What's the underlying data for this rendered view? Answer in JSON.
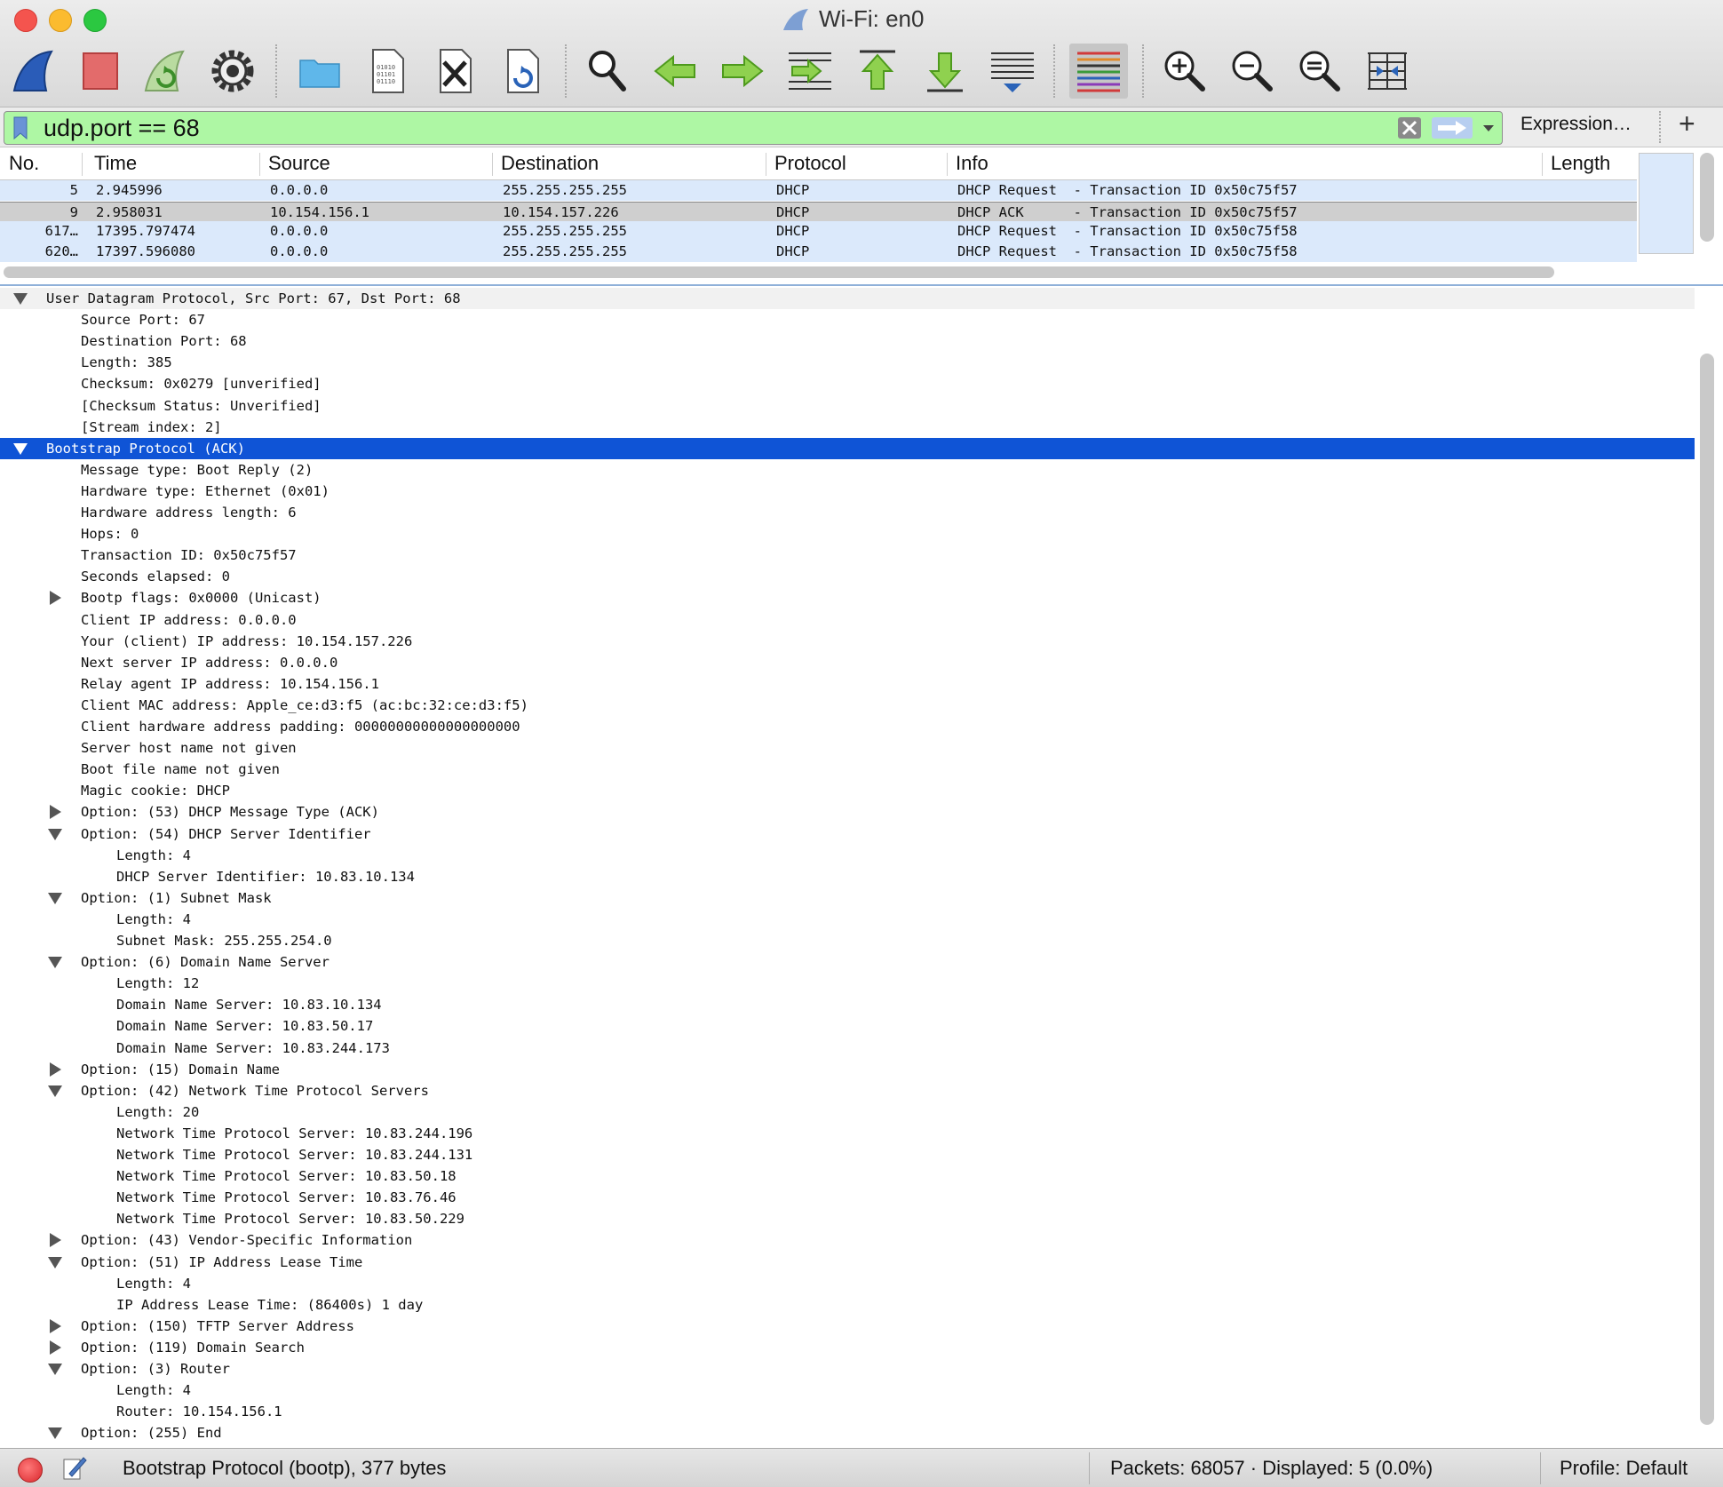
{
  "window": {
    "title": "Wi-Fi: en0",
    "traffic_lights": [
      "#f4544e",
      "#fbbb2f",
      "#2bc841"
    ]
  },
  "toolbar": {
    "buttons": [
      {
        "name": "start-capture",
        "icon": "shark-fin-icon"
      },
      {
        "name": "stop-capture",
        "icon": "stop-square-icon"
      },
      {
        "name": "restart-capture",
        "icon": "restart-fin-icon"
      },
      {
        "name": "capture-options",
        "icon": "gear-icon"
      },
      {
        "name": "open-file",
        "icon": "folder-icon"
      },
      {
        "name": "save-file",
        "icon": "binary-file-icon"
      },
      {
        "name": "close-file",
        "icon": "close-file-icon"
      },
      {
        "name": "reload-file",
        "icon": "reload-file-icon"
      },
      {
        "name": "find-packet",
        "icon": "magnifier-icon"
      },
      {
        "name": "go-back",
        "icon": "arrow-left-icon"
      },
      {
        "name": "go-forward",
        "icon": "arrow-right-icon"
      },
      {
        "name": "go-to-packet",
        "icon": "goto-packet-icon"
      },
      {
        "name": "go-first",
        "icon": "arrow-up-icon"
      },
      {
        "name": "go-last",
        "icon": "arrow-down-icon"
      },
      {
        "name": "auto-scroll",
        "icon": "autoscroll-icon"
      },
      {
        "name": "colorize",
        "icon": "colorize-lines-icon"
      },
      {
        "name": "zoom-in",
        "icon": "zoom-in-icon"
      },
      {
        "name": "zoom-out",
        "icon": "zoom-out-icon"
      },
      {
        "name": "zoom-normal",
        "icon": "zoom-normal-icon"
      },
      {
        "name": "resize-columns",
        "icon": "resize-columns-icon"
      }
    ]
  },
  "filter": {
    "value": "udp.port == 68",
    "expression_label": "Expression…",
    "add_label": "+",
    "bg_color": "#aef7a4"
  },
  "packet_list": {
    "columns": [
      "No.",
      "Time",
      "Source",
      "Destination",
      "Protocol",
      "Info",
      "Length"
    ],
    "rows": [
      {
        "no": "5",
        "time": "2.945996",
        "source": "0.0.0.0",
        "destination": "255.255.255.255",
        "protocol": "DHCP",
        "info": "DHCP Request  - Transaction ID 0x50c75f57",
        "bg": "#dbe9fb"
      },
      {
        "no": "9",
        "time": "2.958031",
        "source": "10.154.156.1",
        "destination": "10.154.157.226",
        "protocol": "DHCP",
        "info": "DHCP ACK      - Transaction ID 0x50c75f57",
        "bg": "#cfcfcf"
      },
      {
        "no": "617…",
        "time": "17395.797474",
        "source": "0.0.0.0",
        "destination": "255.255.255.255",
        "protocol": "DHCP",
        "info": "DHCP Request  - Transaction ID 0x50c75f58",
        "bg": "#dbe9fb"
      },
      {
        "no": "620…",
        "time": "17397.596080",
        "source": "0.0.0.0",
        "destination": "255.255.255.255",
        "protocol": "DHCP",
        "info": "DHCP Request  - Transaction ID 0x50c75f58",
        "bg": "#dbe9fb"
      }
    ]
  },
  "details": [
    {
      "level": 0,
      "tri": "down",
      "text": "User Datagram Protocol, Src Port: 67, Dst Port: 68",
      "bg": "#f1f1f1"
    },
    {
      "level": 1,
      "tri": "",
      "text": "Source Port: 67"
    },
    {
      "level": 1,
      "tri": "",
      "text": "Destination Port: 68"
    },
    {
      "level": 1,
      "tri": "",
      "text": "Length: 385"
    },
    {
      "level": 1,
      "tri": "",
      "text": "Checksum: 0x0279 [unverified]"
    },
    {
      "level": 1,
      "tri": "",
      "text": "[Checksum Status: Unverified]"
    },
    {
      "level": 1,
      "tri": "",
      "text": "[Stream index: 2]"
    },
    {
      "level": 0,
      "tri": "down",
      "text": "Bootstrap Protocol (ACK)",
      "selected": true
    },
    {
      "level": 1,
      "tri": "",
      "text": "Message type: Boot Reply (2)"
    },
    {
      "level": 1,
      "tri": "",
      "text": "Hardware type: Ethernet (0x01)"
    },
    {
      "level": 1,
      "tri": "",
      "text": "Hardware address length: 6"
    },
    {
      "level": 1,
      "tri": "",
      "text": "Hops: 0"
    },
    {
      "level": 1,
      "tri": "",
      "text": "Transaction ID: 0x50c75f57"
    },
    {
      "level": 1,
      "tri": "",
      "text": "Seconds elapsed: 0"
    },
    {
      "level": 1,
      "tri": "right",
      "text": "Bootp flags: 0x0000 (Unicast)"
    },
    {
      "level": 1,
      "tri": "",
      "text": "Client IP address: 0.0.0.0"
    },
    {
      "level": 1,
      "tri": "",
      "text": "Your (client) IP address: 10.154.157.226"
    },
    {
      "level": 1,
      "tri": "",
      "text": "Next server IP address: 0.0.0.0"
    },
    {
      "level": 1,
      "tri": "",
      "text": "Relay agent IP address: 10.154.156.1"
    },
    {
      "level": 1,
      "tri": "",
      "text": "Client MAC address: Apple_ce:d3:f5 (ac:bc:32:ce:d3:f5)"
    },
    {
      "level": 1,
      "tri": "",
      "text": "Client hardware address padding: 00000000000000000000"
    },
    {
      "level": 1,
      "tri": "",
      "text": "Server host name not given"
    },
    {
      "level": 1,
      "tri": "",
      "text": "Boot file name not given"
    },
    {
      "level": 1,
      "tri": "",
      "text": "Magic cookie: DHCP"
    },
    {
      "level": 1,
      "tri": "right",
      "text": "Option: (53) DHCP Message Type (ACK)"
    },
    {
      "level": 1,
      "tri": "down",
      "text": "Option: (54) DHCP Server Identifier"
    },
    {
      "level": 2,
      "tri": "",
      "text": "Length: 4"
    },
    {
      "level": 2,
      "tri": "",
      "text": "DHCP Server Identifier: 10.83.10.134"
    },
    {
      "level": 1,
      "tri": "down",
      "text": "Option: (1) Subnet Mask"
    },
    {
      "level": 2,
      "tri": "",
      "text": "Length: 4"
    },
    {
      "level": 2,
      "tri": "",
      "text": "Subnet Mask: 255.255.254.0"
    },
    {
      "level": 1,
      "tri": "down",
      "text": "Option: (6) Domain Name Server"
    },
    {
      "level": 2,
      "tri": "",
      "text": "Length: 12"
    },
    {
      "level": 2,
      "tri": "",
      "text": "Domain Name Server: 10.83.10.134"
    },
    {
      "level": 2,
      "tri": "",
      "text": "Domain Name Server: 10.83.50.17"
    },
    {
      "level": 2,
      "tri": "",
      "text": "Domain Name Server: 10.83.244.173"
    },
    {
      "level": 1,
      "tri": "right",
      "text": "Option: (15) Domain Name"
    },
    {
      "level": 1,
      "tri": "down",
      "text": "Option: (42) Network Time Protocol Servers"
    },
    {
      "level": 2,
      "tri": "",
      "text": "Length: 20"
    },
    {
      "level": 2,
      "tri": "",
      "text": "Network Time Protocol Server: 10.83.244.196"
    },
    {
      "level": 2,
      "tri": "",
      "text": "Network Time Protocol Server: 10.83.244.131"
    },
    {
      "level": 2,
      "tri": "",
      "text": "Network Time Protocol Server: 10.83.50.18"
    },
    {
      "level": 2,
      "tri": "",
      "text": "Network Time Protocol Server: 10.83.76.46"
    },
    {
      "level": 2,
      "tri": "",
      "text": "Network Time Protocol Server: 10.83.50.229"
    },
    {
      "level": 1,
      "tri": "right",
      "text": "Option: (43) Vendor-Specific Information"
    },
    {
      "level": 1,
      "tri": "down",
      "text": "Option: (51) IP Address Lease Time"
    },
    {
      "level": 2,
      "tri": "",
      "text": "Length: 4"
    },
    {
      "level": 2,
      "tri": "",
      "text": "IP Address Lease Time: (86400s) 1 day"
    },
    {
      "level": 1,
      "tri": "right",
      "text": "Option: (150) TFTP Server Address"
    },
    {
      "level": 1,
      "tri": "right",
      "text": "Option: (119) Domain Search"
    },
    {
      "level": 1,
      "tri": "down",
      "text": "Option: (3) Router"
    },
    {
      "level": 2,
      "tri": "",
      "text": "Length: 4"
    },
    {
      "level": 2,
      "tri": "",
      "text": "Router: 10.154.156.1"
    },
    {
      "level": 1,
      "tri": "down",
      "text": "Option: (255) End"
    }
  ],
  "status": {
    "protocol_text": "Bootstrap Protocol (bootp), 377 bytes",
    "packets_text": "Packets: 68057 · Displayed: 5 (0.0%)",
    "profile_text": "Profile: Default"
  },
  "colors": {
    "selection": "#0f54d6",
    "row_highlight": "#dbe9fb",
    "row_selected_inactive": "#cfcfcf"
  }
}
